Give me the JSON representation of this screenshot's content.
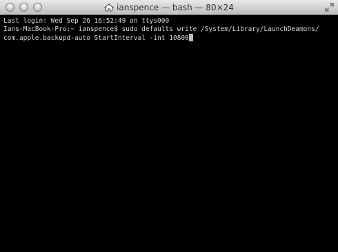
{
  "window": {
    "title": "ianspence — bash — 80×24"
  },
  "terminal": {
    "lines": [
      "Last login: Wed Sep 26 16:52:49 on ttys000",
      "Ians-MacBook-Pro:~ ianspence$ sudo defaults write /System/Library/LaunchDeamons/",
      "com.apple.backupd-auto StartInterval -int 10800"
    ]
  },
  "icons": {
    "title": "home-icon",
    "fullscreen": "fullscreen-icon"
  }
}
